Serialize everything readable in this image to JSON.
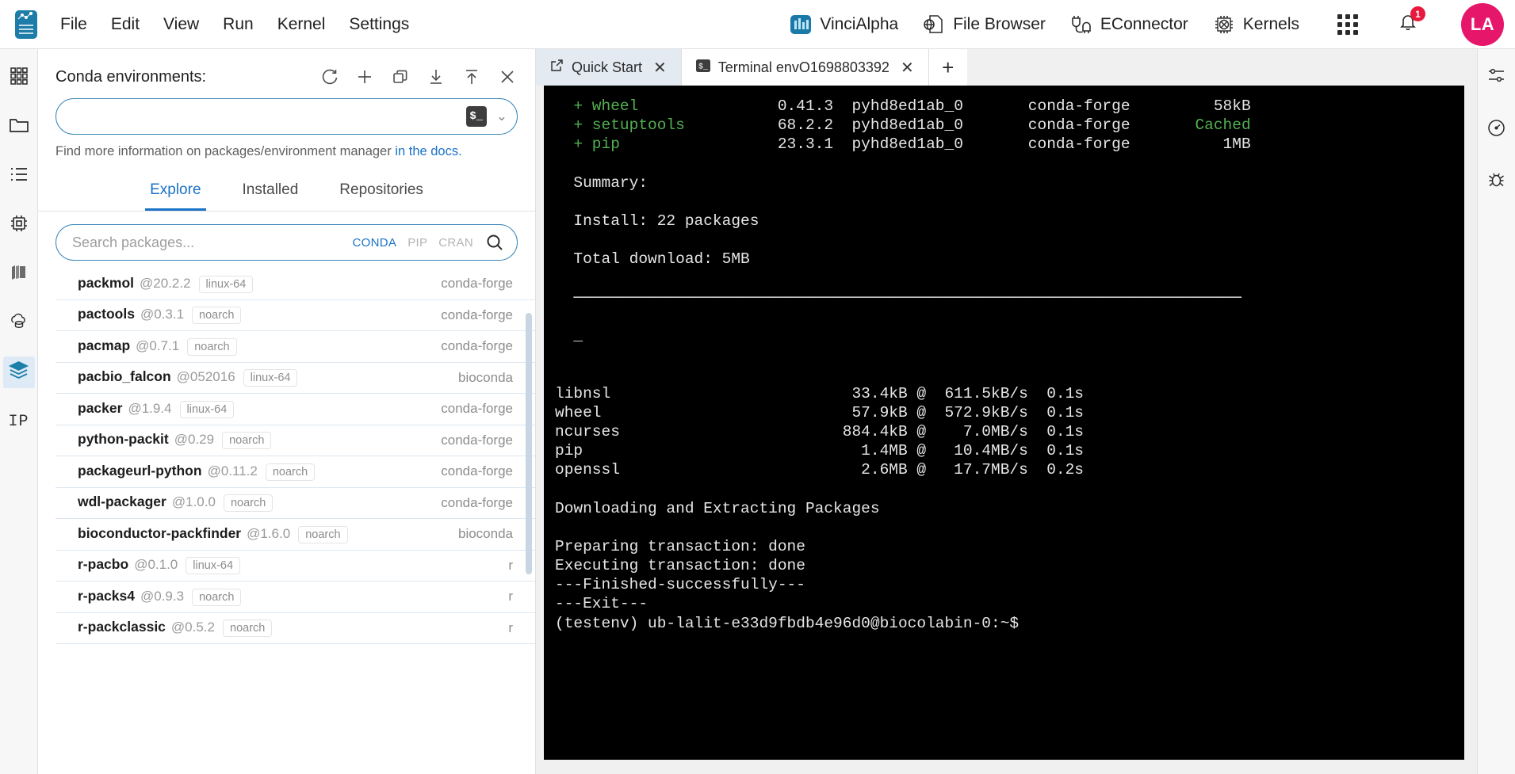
{
  "app": {
    "logo_name": "jupyterlab-logo"
  },
  "menubar": {
    "items": [
      {
        "label": "File",
        "name": "menu-file"
      },
      {
        "label": "Edit",
        "name": "menu-edit"
      },
      {
        "label": "View",
        "name": "menu-view"
      },
      {
        "label": "Run",
        "name": "menu-run"
      },
      {
        "label": "Kernel",
        "name": "menu-kernel"
      },
      {
        "label": "Settings",
        "name": "menu-settings"
      }
    ],
    "tools": [
      {
        "label": "VinciAlpha",
        "icon": "chart-bars-icon"
      },
      {
        "label": "File Browser",
        "icon": "globe-page-icon"
      },
      {
        "label": "EConnector",
        "icon": "plug-cable-icon"
      },
      {
        "label": "Kernels",
        "icon": "cpu-chip-icon"
      }
    ],
    "apps_grid_icon": "grid-apps-icon",
    "notification_icon": "bell-icon",
    "notification_count": "1",
    "avatar_initials": "LA"
  },
  "left_rail": {
    "items": [
      {
        "name": "sidebar-extension-manager",
        "icon": "grid-squares-icon",
        "active": false
      },
      {
        "name": "sidebar-file-browser",
        "icon": "folder-icon",
        "active": false
      },
      {
        "name": "sidebar-running-list",
        "icon": "list-icon",
        "active": false
      },
      {
        "name": "sidebar-kernels",
        "icon": "chip-icon",
        "active": false
      },
      {
        "name": "sidebar-extensions",
        "icon": "books-icon",
        "active": false
      },
      {
        "name": "sidebar-cloud-storage",
        "icon": "cloud-database-icon",
        "active": false
      },
      {
        "name": "sidebar-conda-packages",
        "icon": "layers-icon",
        "active": true
      }
    ],
    "ip_label": "IP"
  },
  "right_rail": {
    "items": [
      {
        "name": "rightbar-settings",
        "icon": "gear-sliders-icon"
      },
      {
        "name": "rightbar-debugger",
        "icon": "gauge-icon"
      },
      {
        "name": "rightbar-bug",
        "icon": "bug-icon"
      }
    ]
  },
  "conda_panel": {
    "title": "Conda environments:",
    "header_actions": [
      {
        "name": "refresh-environments-button",
        "icon": "refresh-icon"
      },
      {
        "name": "create-environment-button",
        "icon": "plus-icon"
      },
      {
        "name": "clone-environment-button",
        "icon": "clone-icon"
      },
      {
        "name": "import-environment-button",
        "icon": "download-icon"
      },
      {
        "name": "export-environment-button",
        "icon": "upload-icon"
      },
      {
        "name": "remove-environment-button",
        "icon": "close-icon"
      }
    ],
    "env_select": {
      "value": "",
      "placeholder": "",
      "badge": "$_",
      "chevron": "⌄"
    },
    "docs_text": "Find more information on packages/environment manager ",
    "docs_link": "in the docs.",
    "tabs": [
      {
        "label": "Explore",
        "active": true
      },
      {
        "label": "Installed",
        "active": false
      },
      {
        "label": "Repositories",
        "active": false
      }
    ],
    "search": {
      "placeholder": "Search packages...",
      "value": "",
      "sources": [
        {
          "label": "CONDA",
          "active": true
        },
        {
          "label": "PIP",
          "active": false
        },
        {
          "label": "CRAN",
          "active": false
        }
      ],
      "search_icon": "search-icon"
    },
    "packages": [
      {
        "name": "packmol",
        "version": "@20.2.2",
        "arch": "linux-64",
        "channel": "conda-forge"
      },
      {
        "name": "pactools",
        "version": "@0.3.1",
        "arch": "noarch",
        "channel": "conda-forge"
      },
      {
        "name": "pacmap",
        "version": "@0.7.1",
        "arch": "noarch",
        "channel": "conda-forge"
      },
      {
        "name": "pacbio_falcon",
        "version": "@052016",
        "arch": "linux-64",
        "channel": "bioconda"
      },
      {
        "name": "packer",
        "version": "@1.9.4",
        "arch": "linux-64",
        "channel": "conda-forge"
      },
      {
        "name": "python-packit",
        "version": "@0.29",
        "arch": "noarch",
        "channel": "conda-forge"
      },
      {
        "name": "packageurl-python",
        "version": "@0.11.2",
        "arch": "noarch",
        "channel": "conda-forge"
      },
      {
        "name": "wdl-packager",
        "version": "@1.0.0",
        "arch": "noarch",
        "channel": "conda-forge"
      },
      {
        "name": "bioconductor-packfinder",
        "version": "@1.6.0",
        "arch": "noarch",
        "channel": "bioconda"
      },
      {
        "name": "r-pacbo",
        "version": "@0.1.0",
        "arch": "linux-64",
        "channel": "r"
      },
      {
        "name": "r-packs4",
        "version": "@0.9.3",
        "arch": "noarch",
        "channel": "r"
      },
      {
        "name": "r-packclassic",
        "version": "@0.5.2",
        "arch": "noarch",
        "channel": "r"
      }
    ]
  },
  "dock": {
    "tabs": [
      {
        "label": "Quick Start",
        "icon": "launch-icon",
        "active": false,
        "close": "✕"
      },
      {
        "label": "Terminal envO1698803392",
        "icon": "terminal-icon",
        "active": true,
        "close": "✕"
      }
    ],
    "add_tab_label": "+"
  },
  "terminal": {
    "lines": [
      {
        "segments": [
          {
            "t": "  + wheel                0.41.3  pyhd8ed1ab_0       conda-forge       58kB",
            "c": "mixed-wheel"
          }
        ]
      },
      {
        "segments": [
          {
            "t": "  + setuptools           68.2.2  pyhd8ed1ab_0       conda-forge      Cached",
            "c": "mixed-setuptools"
          }
        ]
      },
      {
        "segments": [
          {
            "t": "  + pip                  23.3.1  pyhd8ed1ab_0       conda-forge        1MB",
            "c": "mixed-pip"
          }
        ]
      },
      {
        "segments": [
          {
            "t": "",
            "c": "plain"
          }
        ]
      },
      {
        "segments": [
          {
            "t": "  Summary:",
            "c": "plain"
          }
        ]
      },
      {
        "segments": [
          {
            "t": "",
            "c": "plain"
          }
        ]
      },
      {
        "segments": [
          {
            "t": "  Install: 22 packages",
            "c": "plain"
          }
        ]
      },
      {
        "segments": [
          {
            "t": "",
            "c": "plain"
          }
        ]
      },
      {
        "segments": [
          {
            "t": "  Total download: 5MB",
            "c": "plain"
          }
        ]
      },
      {
        "segments": [
          {
            "t": "",
            "c": "plain"
          }
        ]
      },
      {
        "segments": [
          {
            "t": "  ────────────────────────────────────────────────────────────────────────",
            "c": "plain"
          }
        ]
      },
      {
        "segments": [
          {
            "t": "",
            "c": "plain"
          }
        ]
      },
      {
        "segments": [
          {
            "t": "  _",
            "c": "plain"
          }
        ]
      },
      {
        "segments": [
          {
            "t": "",
            "c": "plain"
          }
        ]
      },
      {
        "segments": [
          {
            "t": "",
            "c": "plain"
          }
        ]
      },
      {
        "segments": [
          {
            "t": "libnsl                              33.4kB @ 611.5kB/s  0.1s",
            "c": "plain"
          }
        ]
      },
      {
        "segments": [
          {
            "t": "wheel                               57.9kB @ 572.9kB/s  0.1s",
            "c": "plain"
          }
        ]
      },
      {
        "segments": [
          {
            "t": "ncurses                            884.4kB @   7.0MB/s  0.1s",
            "c": "plain"
          }
        ]
      },
      {
        "segments": [
          {
            "t": "pip                                  1.4MB @  10.4MB/s  0.1s",
            "c": "plain"
          }
        ]
      },
      {
        "segments": [
          {
            "t": "openssl                              2.6MB @  17.7MB/s  0.2s",
            "c": "plain"
          }
        ]
      },
      {
        "segments": [
          {
            "t": "",
            "c": "plain"
          }
        ]
      },
      {
        "segments": [
          {
            "t": "Downloading and Extracting Packages",
            "c": "plain"
          }
        ]
      },
      {
        "segments": [
          {
            "t": "",
            "c": "plain"
          }
        ]
      },
      {
        "segments": [
          {
            "t": "Preparing transaction: done",
            "c": "plain"
          }
        ]
      },
      {
        "segments": [
          {
            "t": "Executing transaction: done",
            "c": "plain"
          }
        ]
      },
      {
        "segments": [
          {
            "t": "---Finished-successfully---",
            "c": "plain"
          }
        ]
      },
      {
        "segments": [
          {
            "t": "---Exit---",
            "c": "plain"
          }
        ]
      },
      {
        "segments": [
          {
            "t": "(testenv) ub-lalit-e33d9fbdb4e96d0@biocolabin-0:~$",
            "c": "plain"
          }
        ]
      }
    ],
    "install_rows": [
      {
        "mark": "+",
        "pkg": "wheel",
        "version": "0.41.3",
        "build": "pyhd8ed1ab_0",
        "channel": "conda-forge",
        "size": "58kB",
        "cached": false
      },
      {
        "mark": "+",
        "pkg": "setuptools",
        "version": "68.2.2",
        "build": "pyhd8ed1ab_0",
        "channel": "conda-forge",
        "size": "Cached",
        "cached": true
      },
      {
        "mark": "+",
        "pkg": "pip",
        "version": "23.3.1",
        "build": "pyhd8ed1ab_0",
        "channel": "conda-forge",
        "size": "1MB",
        "cached": false
      }
    ],
    "summary_label": "Summary:",
    "install_summary": "Install: 22 packages",
    "total_download": "Total download: 5MB",
    "cursor": "_",
    "downloads": [
      {
        "pkg": "libnsl",
        "size": "33.4kB",
        "speed": "611.5kB/s",
        "time": "0.1s"
      },
      {
        "pkg": "wheel",
        "size": "57.9kB",
        "speed": "572.9kB/s",
        "time": "0.1s"
      },
      {
        "pkg": "ncurses",
        "size": "884.4kB",
        "speed": "7.0MB/s",
        "time": "0.1s"
      },
      {
        "pkg": "pip",
        "size": "1.4MB",
        "speed": "10.4MB/s",
        "time": "0.1s"
      },
      {
        "pkg": "openssl",
        "size": "2.6MB",
        "speed": "17.7MB/s",
        "time": "0.2s"
      }
    ],
    "status_lines": [
      "Downloading and Extracting Packages",
      "",
      "Preparing transaction: done",
      "Executing transaction: done",
      "---Finished-successfully---",
      "---Exit---"
    ],
    "prompt": "(testenv) ub-lalit-e33d9fbdb4e96d0@biocolabin-0:~$"
  },
  "colors": {
    "accent_blue": "#1a73c7",
    "avatar_pink": "#e6176b",
    "badge_red": "#e8193c",
    "terminal_green": "#52b052",
    "terminal_bg": "#000000"
  }
}
